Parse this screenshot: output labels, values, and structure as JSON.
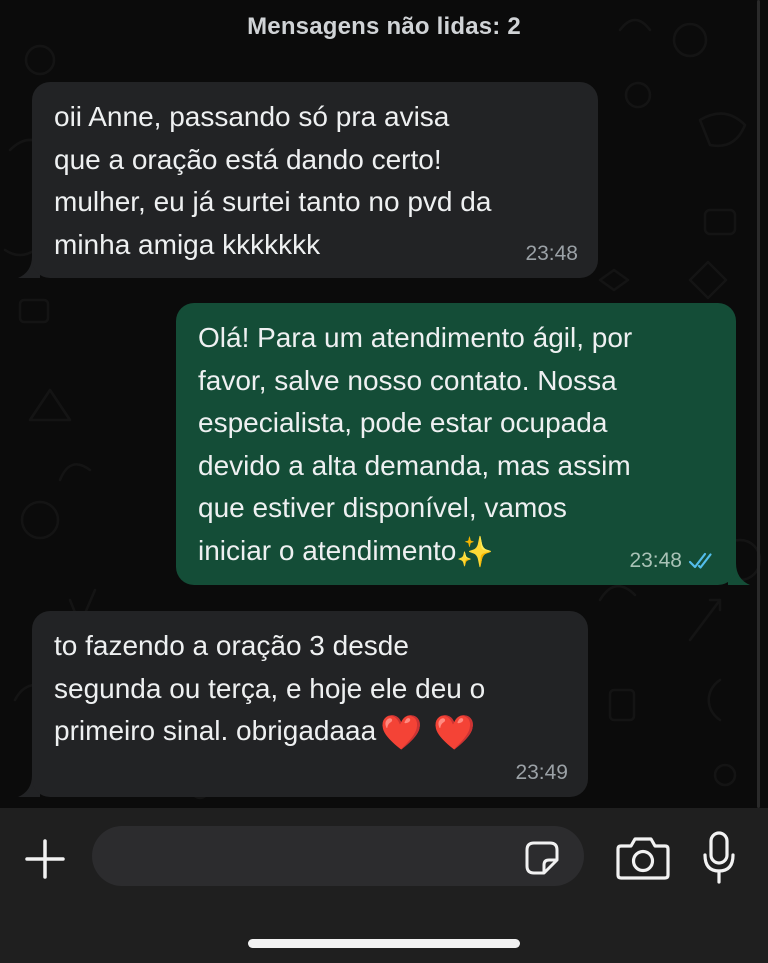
{
  "unread_banner": "Mensagens não lidas: 2",
  "messages": [
    {
      "direction": "incoming",
      "lines": [
        "oii Anne, passando só pra avisa",
        "que a oração está dando certo!",
        "mulher, eu já surtei tanto no pvd da",
        "minha amiga kkkkkkk"
      ],
      "time": "23:48"
    },
    {
      "direction": "outgoing",
      "lines": [
        "Olá! Para um atendimento ágil, por",
        "favor, salve nosso contato. Nossa",
        "especialista, pode estar ocupada",
        "devido a alta demanda, mas assim",
        "que estiver disponível, vamos",
        "iniciar o atendimento"
      ],
      "trailing_emoji": "✨",
      "time": "23:48",
      "status_icon": "double-check-read-icon"
    },
    {
      "direction": "incoming",
      "lines": [
        "to fazendo a oração 3 desde",
        "segunda ou terça, e hoje ele deu o",
        "primeiro sinal. obrigadaaa"
      ],
      "trailing_emoji": "❤️ ❤️",
      "time": "23:49"
    }
  ],
  "composer": {
    "placeholder": "",
    "icons": [
      "plus-icon",
      "sticker-icon",
      "camera-icon",
      "microphone-icon"
    ]
  },
  "colors": {
    "background": "#0b0b0b",
    "incoming_bubble": "#222325",
    "outgoing_bubble": "#144d37",
    "read_check": "#53bdeb",
    "composer_bar": "#1f1f1f"
  }
}
